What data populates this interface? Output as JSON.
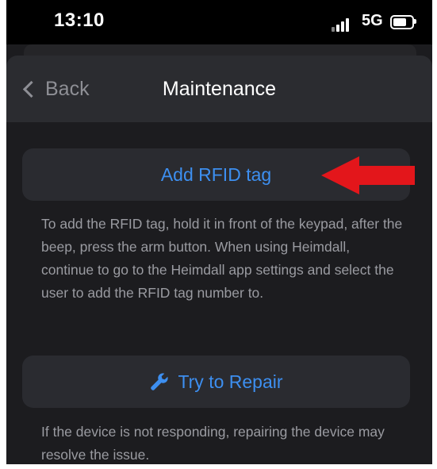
{
  "status_bar": {
    "time": "13:10",
    "network": "5G",
    "signal_icon": "cellular-signal-icon",
    "battery_icon": "battery-icon"
  },
  "nav": {
    "back_label": "Back",
    "title": "Maintenance"
  },
  "add_rfid": {
    "label": "Add RFID tag",
    "description": "To add the RFID tag, hold it in front of the keypad, after the beep, press the arm button. When using Heimdall, continue to go to the Heimdall app settings and select the user to add the RFID tag number to."
  },
  "repair": {
    "label": "Try to Repair",
    "icon": "wrench-icon",
    "description": "If the device is not responding, repairing the device may resolve the issue."
  },
  "annotation": {
    "icon": "red-arrow-icon",
    "color": "#e3161b"
  },
  "colors": {
    "accent": "#3d8ff0",
    "background": "#1c1c1f",
    "card": "#2a2b30"
  }
}
